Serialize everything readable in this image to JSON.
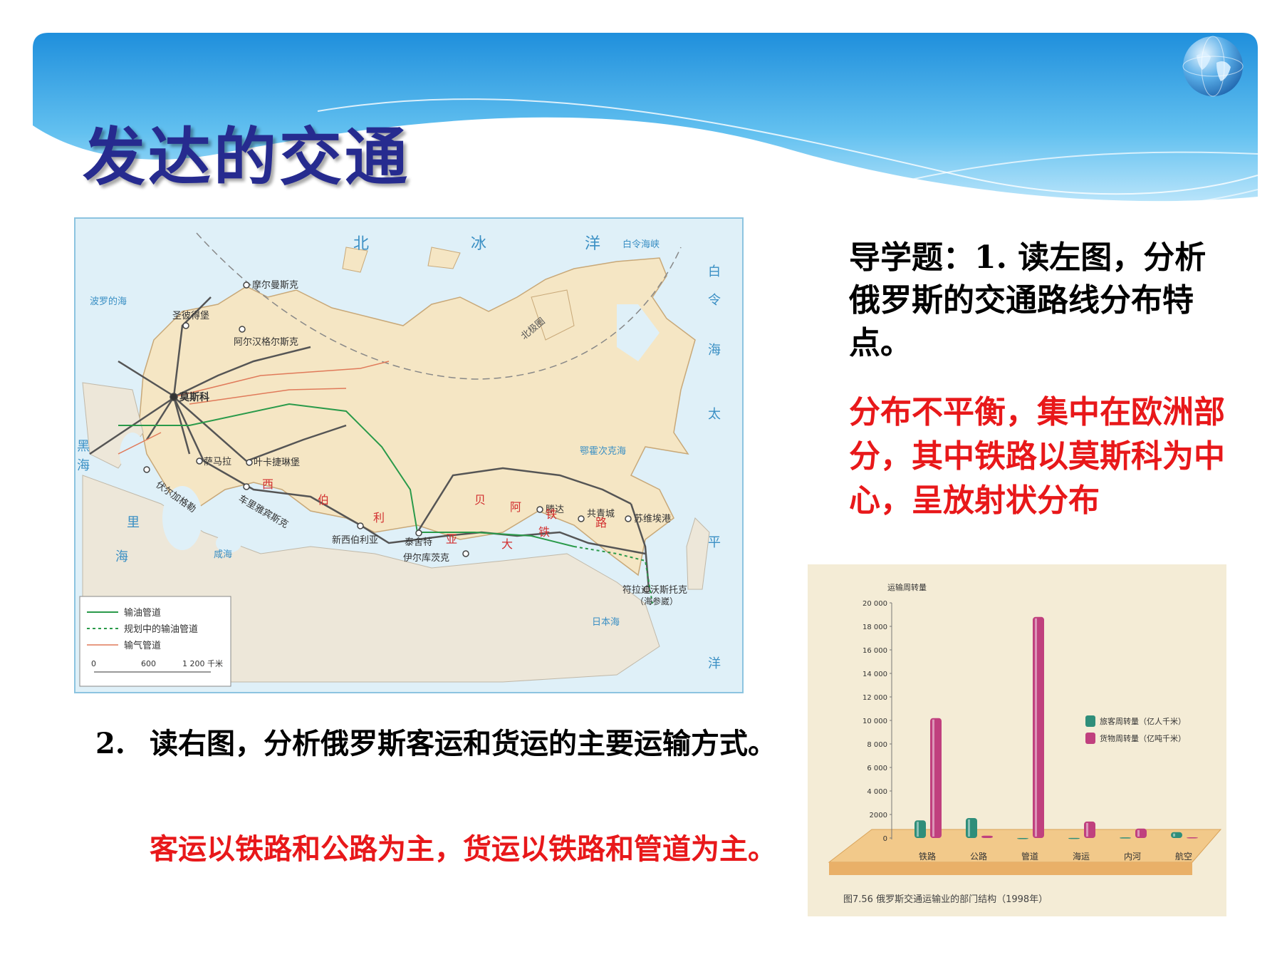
{
  "slide": {
    "title": "发达的交通",
    "question1": "导学题：1. 读左图，分析俄罗斯的交通路线分布特点。",
    "answer1": "分布不平衡，集中在欧洲部分，其中铁路以莫斯科为中心，呈放射状分布",
    "question2_number": "2.",
    "question2": "读右图，分析俄罗斯客运和货运的主要运输方式。",
    "answer2": "客运以铁路和公路为主，货运以铁路和管道为主。"
  },
  "map": {
    "ocean_label": [
      "北",
      "冰",
      "洋"
    ],
    "sea_labels": {
      "white_sea": "白令海峡",
      "baltic": "波罗的海",
      "black_sea": [
        "黑",
        "海"
      ],
      "caspian": [
        "里",
        "海"
      ],
      "okhotsk": "鄂霍次克海",
      "japan_sea": "日本海",
      "bering": [
        "白",
        "令",
        "海"
      ],
      "pacific": [
        "太",
        "平",
        "洋"
      ],
      "salt_lake": "咸海"
    },
    "cities": {
      "murmansk": "摩尔曼斯克",
      "st_petersburg": "圣彼得堡",
      "arkhangelsk": "阿尔汉格尔斯克",
      "moscow": "莫斯科",
      "samara": "萨马拉",
      "yekaterinburg": "叶卡捷琳堡",
      "volgograd": "伏尔加格勒",
      "chelyabinsk": "车里雅宾斯克",
      "novosibirsk": "新西伯利亚",
      "taishet": "泰舍特",
      "irkutsk": "伊尔库茨克",
      "tynda": "滕达",
      "komsomolsk": "共青城",
      "sovetskaya_gavan": "苏维埃港",
      "vladivostok": "符拉迪沃斯托克",
      "vladivostok_note": "（海参崴）"
    },
    "railway_labels": {
      "siberian": [
        "西",
        "伯",
        "利",
        "亚"
      ],
      "baikal_amur": [
        "贝",
        "阿",
        "铁",
        "路"
      ],
      "big_rail": [
        "大",
        "铁"
      ]
    },
    "arctic_circle": "北极圈",
    "legend": {
      "oil_pipeline": "输油管道",
      "planned_oil_pipeline": "规划中的输油管道",
      "gas_pipeline": "输气管道"
    },
    "scale": [
      "0",
      "600",
      "1 200 千米"
    ]
  },
  "chart_data": {
    "type": "bar",
    "title": "图7.56  俄罗斯交通运输业的部门结构（1998年）",
    "ylabel": "运输周转量",
    "categories": [
      "铁路",
      "公路",
      "管道",
      "海运",
      "内河",
      "航空"
    ],
    "yticks": [
      "20 000",
      "18 000",
      "16 000",
      "14 000",
      "12 000",
      "10 000",
      "8 000",
      "6 000",
      "4 000",
      "2000",
      "0"
    ],
    "ylim": [
      0,
      20000
    ],
    "series": [
      {
        "name": "旅客周转量（亿人千米）",
        "color": "#2f8e7a",
        "values": [
          1500,
          1700,
          0,
          10,
          50,
          500
        ]
      },
      {
        "name": "货物周转量（亿吨千米）",
        "color": "#c0407e",
        "values": [
          10200,
          200,
          18800,
          1400,
          800,
          60
        ]
      }
    ],
    "legend_position": "right",
    "grid": false
  },
  "colors": {
    "title": "#262b8f",
    "answer": "#e8181a",
    "banner": "#3aa0e0"
  }
}
